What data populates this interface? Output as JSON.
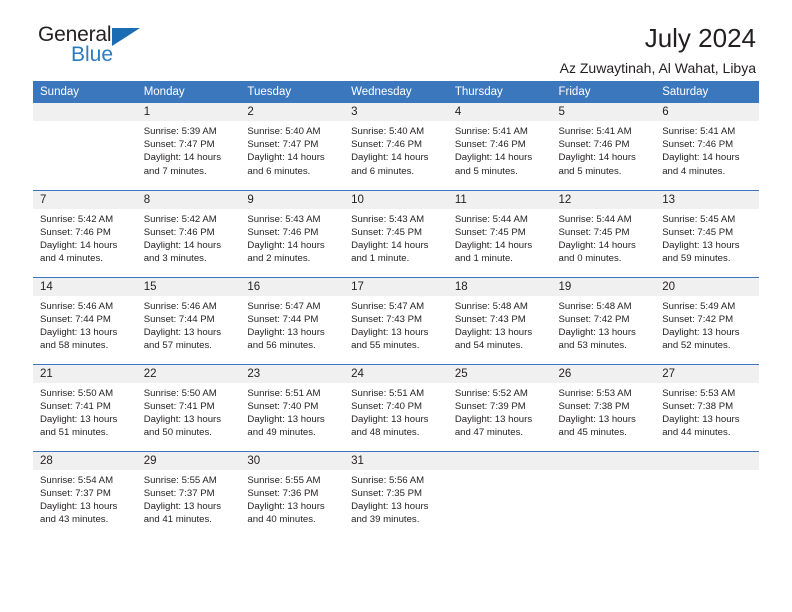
{
  "brand": {
    "name_top": "General",
    "name_bottom": "Blue",
    "triangle_color": "#1b6cb3",
    "text_color": "#231f20",
    "blue_text_color": "#2b7cc2"
  },
  "header": {
    "title": "July 2024",
    "location": "Az Zuwaytinah, Al Wahat, Libya"
  },
  "theme": {
    "header_blue": "#3b77bd",
    "daynum_bg": "#f0f0f0",
    "text": "#231f20"
  },
  "weekdays": [
    "Sunday",
    "Monday",
    "Tuesday",
    "Wednesday",
    "Thursday",
    "Friday",
    "Saturday"
  ],
  "weeks": [
    [
      {
        "day": "",
        "sunrise": "",
        "sunset": "",
        "daylight": ""
      },
      {
        "day": "1",
        "sunrise": "Sunrise: 5:39 AM",
        "sunset": "Sunset: 7:47 PM",
        "daylight": "Daylight: 14 hours and 7 minutes."
      },
      {
        "day": "2",
        "sunrise": "Sunrise: 5:40 AM",
        "sunset": "Sunset: 7:47 PM",
        "daylight": "Daylight: 14 hours and 6 minutes."
      },
      {
        "day": "3",
        "sunrise": "Sunrise: 5:40 AM",
        "sunset": "Sunset: 7:46 PM",
        "daylight": "Daylight: 14 hours and 6 minutes."
      },
      {
        "day": "4",
        "sunrise": "Sunrise: 5:41 AM",
        "sunset": "Sunset: 7:46 PM",
        "daylight": "Daylight: 14 hours and 5 minutes."
      },
      {
        "day": "5",
        "sunrise": "Sunrise: 5:41 AM",
        "sunset": "Sunset: 7:46 PM",
        "daylight": "Daylight: 14 hours and 5 minutes."
      },
      {
        "day": "6",
        "sunrise": "Sunrise: 5:41 AM",
        "sunset": "Sunset: 7:46 PM",
        "daylight": "Daylight: 14 hours and 4 minutes."
      }
    ],
    [
      {
        "day": "7",
        "sunrise": "Sunrise: 5:42 AM",
        "sunset": "Sunset: 7:46 PM",
        "daylight": "Daylight: 14 hours and 4 minutes."
      },
      {
        "day": "8",
        "sunrise": "Sunrise: 5:42 AM",
        "sunset": "Sunset: 7:46 PM",
        "daylight": "Daylight: 14 hours and 3 minutes."
      },
      {
        "day": "9",
        "sunrise": "Sunrise: 5:43 AM",
        "sunset": "Sunset: 7:46 PM",
        "daylight": "Daylight: 14 hours and 2 minutes."
      },
      {
        "day": "10",
        "sunrise": "Sunrise: 5:43 AM",
        "sunset": "Sunset: 7:45 PM",
        "daylight": "Daylight: 14 hours and 1 minute."
      },
      {
        "day": "11",
        "sunrise": "Sunrise: 5:44 AM",
        "sunset": "Sunset: 7:45 PM",
        "daylight": "Daylight: 14 hours and 1 minute."
      },
      {
        "day": "12",
        "sunrise": "Sunrise: 5:44 AM",
        "sunset": "Sunset: 7:45 PM",
        "daylight": "Daylight: 14 hours and 0 minutes."
      },
      {
        "day": "13",
        "sunrise": "Sunrise: 5:45 AM",
        "sunset": "Sunset: 7:45 PM",
        "daylight": "Daylight: 13 hours and 59 minutes."
      }
    ],
    [
      {
        "day": "14",
        "sunrise": "Sunrise: 5:46 AM",
        "sunset": "Sunset: 7:44 PM",
        "daylight": "Daylight: 13 hours and 58 minutes."
      },
      {
        "day": "15",
        "sunrise": "Sunrise: 5:46 AM",
        "sunset": "Sunset: 7:44 PM",
        "daylight": "Daylight: 13 hours and 57 minutes."
      },
      {
        "day": "16",
        "sunrise": "Sunrise: 5:47 AM",
        "sunset": "Sunset: 7:44 PM",
        "daylight": "Daylight: 13 hours and 56 minutes."
      },
      {
        "day": "17",
        "sunrise": "Sunrise: 5:47 AM",
        "sunset": "Sunset: 7:43 PM",
        "daylight": "Daylight: 13 hours and 55 minutes."
      },
      {
        "day": "18",
        "sunrise": "Sunrise: 5:48 AM",
        "sunset": "Sunset: 7:43 PM",
        "daylight": "Daylight: 13 hours and 54 minutes."
      },
      {
        "day": "19",
        "sunrise": "Sunrise: 5:48 AM",
        "sunset": "Sunset: 7:42 PM",
        "daylight": "Daylight: 13 hours and 53 minutes."
      },
      {
        "day": "20",
        "sunrise": "Sunrise: 5:49 AM",
        "sunset": "Sunset: 7:42 PM",
        "daylight": "Daylight: 13 hours and 52 minutes."
      }
    ],
    [
      {
        "day": "21",
        "sunrise": "Sunrise: 5:50 AM",
        "sunset": "Sunset: 7:41 PM",
        "daylight": "Daylight: 13 hours and 51 minutes."
      },
      {
        "day": "22",
        "sunrise": "Sunrise: 5:50 AM",
        "sunset": "Sunset: 7:41 PM",
        "daylight": "Daylight: 13 hours and 50 minutes."
      },
      {
        "day": "23",
        "sunrise": "Sunrise: 5:51 AM",
        "sunset": "Sunset: 7:40 PM",
        "daylight": "Daylight: 13 hours and 49 minutes."
      },
      {
        "day": "24",
        "sunrise": "Sunrise: 5:51 AM",
        "sunset": "Sunset: 7:40 PM",
        "daylight": "Daylight: 13 hours and 48 minutes."
      },
      {
        "day": "25",
        "sunrise": "Sunrise: 5:52 AM",
        "sunset": "Sunset: 7:39 PM",
        "daylight": "Daylight: 13 hours and 47 minutes."
      },
      {
        "day": "26",
        "sunrise": "Sunrise: 5:53 AM",
        "sunset": "Sunset: 7:38 PM",
        "daylight": "Daylight: 13 hours and 45 minutes."
      },
      {
        "day": "27",
        "sunrise": "Sunrise: 5:53 AM",
        "sunset": "Sunset: 7:38 PM",
        "daylight": "Daylight: 13 hours and 44 minutes."
      }
    ],
    [
      {
        "day": "28",
        "sunrise": "Sunrise: 5:54 AM",
        "sunset": "Sunset: 7:37 PM",
        "daylight": "Daylight: 13 hours and 43 minutes."
      },
      {
        "day": "29",
        "sunrise": "Sunrise: 5:55 AM",
        "sunset": "Sunset: 7:37 PM",
        "daylight": "Daylight: 13 hours and 41 minutes."
      },
      {
        "day": "30",
        "sunrise": "Sunrise: 5:55 AM",
        "sunset": "Sunset: 7:36 PM",
        "daylight": "Daylight: 13 hours and 40 minutes."
      },
      {
        "day": "31",
        "sunrise": "Sunrise: 5:56 AM",
        "sunset": "Sunset: 7:35 PM",
        "daylight": "Daylight: 13 hours and 39 minutes."
      },
      {
        "day": "",
        "sunrise": "",
        "sunset": "",
        "daylight": ""
      },
      {
        "day": "",
        "sunrise": "",
        "sunset": "",
        "daylight": ""
      },
      {
        "day": "",
        "sunrise": "",
        "sunset": "",
        "daylight": ""
      }
    ]
  ]
}
